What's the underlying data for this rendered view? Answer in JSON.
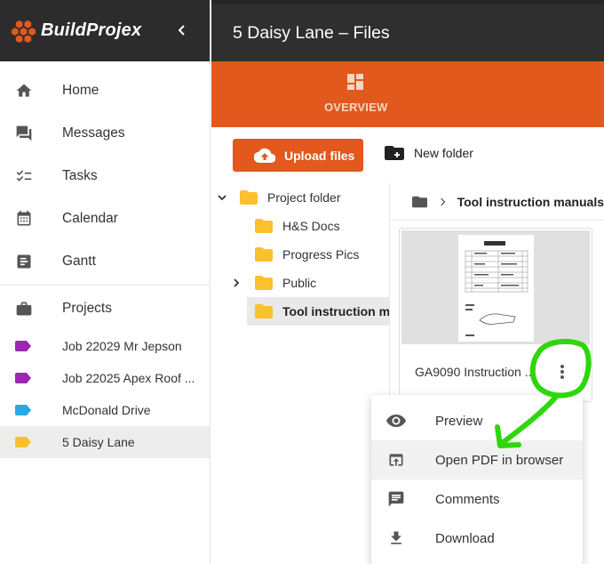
{
  "app": {
    "brand": "BuildProjex",
    "title": "5 Daisy Lane – Files"
  },
  "colors": {
    "accent": "#e2581d",
    "header": "#2f2f2f",
    "annotation": "#2fd60c"
  },
  "sidebar": {
    "nav": [
      {
        "label": "Home",
        "icon": "home-icon"
      },
      {
        "label": "Messages",
        "icon": "chat-icon"
      },
      {
        "label": "Tasks",
        "icon": "checklist-icon"
      },
      {
        "label": "Calendar",
        "icon": "calendar-icon"
      },
      {
        "label": "Gantt",
        "icon": "gantt-icon"
      }
    ],
    "projects_label": "Projects",
    "projects": [
      {
        "label": "Job 22029 Mr Jepson",
        "color": "#9c27b0"
      },
      {
        "label": "Job 22025 Apex Roof ...",
        "color": "#9c27b0"
      },
      {
        "label": "McDonald Drive",
        "color": "#29a8e8"
      },
      {
        "label": "5 Daisy Lane",
        "color": "#fbc02d",
        "active": true
      }
    ]
  },
  "ribbon": {
    "overview_label": "OVERVIEW"
  },
  "toolbar": {
    "upload_label": "Upload files",
    "new_folder_label": "New folder"
  },
  "tree": {
    "root": "Project folder",
    "children": [
      "H&S Docs",
      "Progress Pics",
      "Public",
      "Tool instruction manuals"
    ]
  },
  "breadcrumb": {
    "current": "Tool instruction manuals"
  },
  "file": {
    "name": "GA9090 Instruction ..."
  },
  "context_menu": {
    "items": [
      {
        "label": "Preview",
        "icon": "eye-icon"
      },
      {
        "label": "Open PDF in browser",
        "icon": "open-in-browser-icon"
      },
      {
        "label": "Comments",
        "icon": "comment-icon"
      },
      {
        "label": "Download",
        "icon": "download-icon"
      }
    ]
  }
}
